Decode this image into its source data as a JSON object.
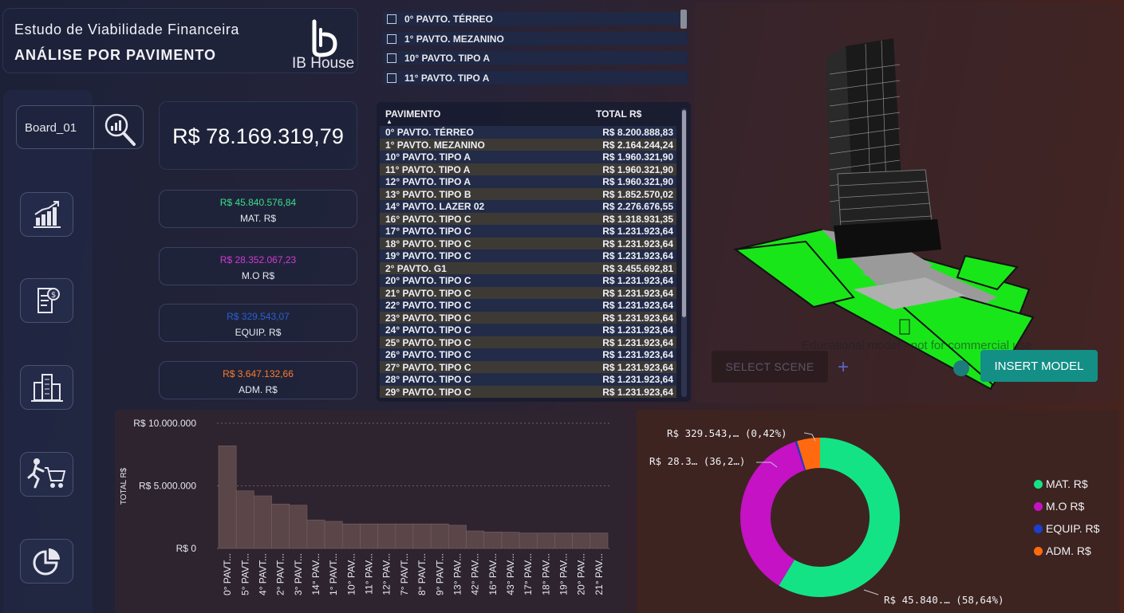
{
  "header": {
    "title_line1": "Estudo de Viabilidade Financeira",
    "title_line2": "ANÁLISE POR PAVIMENTO",
    "brand": "IB House"
  },
  "board": {
    "label": "Board_01",
    "icon": "search-chart-icon"
  },
  "sidebar": {
    "items": [
      {
        "icon": "growth-chart-icon"
      },
      {
        "icon": "invoice-icon"
      },
      {
        "icon": "buildings-icon"
      },
      {
        "icon": "shopping-cart-icon"
      },
      {
        "icon": "pie-chart-icon"
      }
    ]
  },
  "kpis": {
    "total": "R$ 78.169.319,79",
    "items": [
      {
        "value": "R$ 45.840.576,84",
        "label": "MAT. R$",
        "color": "#38e08a"
      },
      {
        "value": "R$ 28.352.067,23",
        "label": "M.O R$",
        "color": "#d23ad2"
      },
      {
        "value": "R$ 329.543,07",
        "label": "EQUIP. R$",
        "color": "#2a5fd0"
      },
      {
        "value": "R$ 3.647.132,66",
        "label": "ADM. R$",
        "color": "#ff7a2a"
      }
    ]
  },
  "slicer": {
    "items": [
      "0° PAVTO. TÉRREO",
      "1° PAVTO. MEZANINO",
      "10° PAVTO. TIPO A",
      "11° PAVTO. TIPO A"
    ]
  },
  "table": {
    "headers": [
      "PAVIMENTO",
      "TOTAL R$"
    ],
    "rows": [
      [
        "0° PAVTO. TÉRREO",
        "R$ 8.200.888,83"
      ],
      [
        "1° PAVTO. MEZANINO",
        "R$ 2.164.244,24"
      ],
      [
        "10° PAVTO. TIPO A",
        "R$ 1.960.321,90"
      ],
      [
        "11° PAVTO. TIPO A",
        "R$ 1.960.321,90"
      ],
      [
        "12° PAVTO. TIPO A",
        "R$ 1.960.321,90"
      ],
      [
        "13° PAVTO. TIPO B",
        "R$ 1.852.570,02"
      ],
      [
        "14° PAVTO. LAZER 02",
        "R$ 2.276.676,55"
      ],
      [
        "16° PAVTO. TIPO C",
        "R$ 1.318.931,35"
      ],
      [
        "17° PAVTO. TIPO C",
        "R$ 1.231.923,64"
      ],
      [
        "18° PAVTO. TIPO C",
        "R$ 1.231.923,64"
      ],
      [
        "19° PAVTO. TIPO C",
        "R$ 1.231.923,64"
      ],
      [
        "2° PAVTO. G1",
        "R$ 3.455.692,81"
      ],
      [
        "20° PAVTO. TIPO C",
        "R$ 1.231.923,64"
      ],
      [
        "21° PAVTO. TIPO C",
        "R$ 1.231.923,64"
      ],
      [
        "22° PAVTO. TIPO C",
        "R$ 1.231.923,64"
      ],
      [
        "23° PAVTO. TIPO C",
        "R$ 1.231.923,64"
      ],
      [
        "24° PAVTO. TIPO C",
        "R$ 1.231.923,64"
      ],
      [
        "25° PAVTO. TIPO C",
        "R$ 1.231.923,64"
      ],
      [
        "26° PAVTO. TIPO C",
        "R$ 1.231.923,64"
      ],
      [
        "27° PAVTO. TIPO C",
        "R$ 1.231.923,64"
      ],
      [
        "28° PAVTO. TIPO C",
        "R$ 1.231.923,64"
      ],
      [
        "29° PAVTO. TIPO C",
        "R$ 1.231.923,64"
      ]
    ]
  },
  "model_viewer": {
    "select_scene": "SELECT SCENE",
    "insert_model": "INSERT MODEL",
    "watermark": "Educational model - not for commercial use"
  },
  "chart_data": [
    {
      "type": "bar",
      "ylabel": "TOTAL R$",
      "ylim": [
        0,
        10000000
      ],
      "yticks": [
        "R$ 0",
        "R$ 5.000.000",
        "R$ 10.000.000"
      ],
      "grid": true,
      "categories": [
        "0° PAVT...",
        "5° PAVT...",
        "4° PAVT...",
        "2° PAVT...",
        "3° PAVT...",
        "14° PAV...",
        "1° PAVT...",
        "10° PAV...",
        "11° PAV...",
        "12° PAV...",
        "7° PAVT...",
        "8° PAVT...",
        "9° PAVT...",
        "13° PAV...",
        "42° PAV...",
        "16° PAV...",
        "43° PAV...",
        "17° PAV...",
        "18° PAV...",
        "19° PAV...",
        "20° PAV...",
        "21° PAV..."
      ],
      "values": [
        8200889,
        4600000,
        4200000,
        3550000,
        3455693,
        2276677,
        2164244,
        1960322,
        1960322,
        1960322,
        1960322,
        1960322,
        1960322,
        1852570,
        1400000,
        1318931,
        1300000,
        1231924,
        1231924,
        1231924,
        1231924,
        1231924
      ]
    },
    {
      "type": "pie",
      "categories": [
        "MAT. R$",
        "M.O R$",
        "EQUIP. R$",
        "ADM. R$"
      ],
      "values": [
        45840576.84,
        28352067.23,
        329543.07,
        3647132.66
      ],
      "colors": [
        "#14e385",
        "#c412c4",
        "#1a3fd0",
        "#ff6a10"
      ],
      "legend": "right",
      "labels": [
        {
          "text": "R$ 45.840.… (58,64%)"
        },
        {
          "text": "R$ 28.3… (36,2…)"
        },
        {
          "text": "R$ 329.543,… (0,42%)"
        }
      ]
    }
  ]
}
